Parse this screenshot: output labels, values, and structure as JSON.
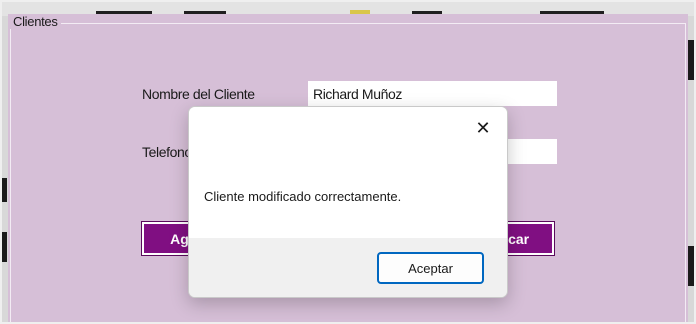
{
  "form": {
    "group_title": "Clientes",
    "client_name_label": "Nombre del Cliente",
    "client_name_value": "Richard Muñoz",
    "phone_label": "Telefono",
    "phone_value": "",
    "add_button_label": "Agregar",
    "modify_button_label": "Modificar"
  },
  "dialog": {
    "close_glyph": "✕",
    "message": "Cliente modificado correctamente.",
    "ok_label": "Aceptar"
  },
  "colors": {
    "form_background": "#d6bfd7",
    "button_background": "#800f82",
    "dialog_accent": "#0067c0"
  }
}
